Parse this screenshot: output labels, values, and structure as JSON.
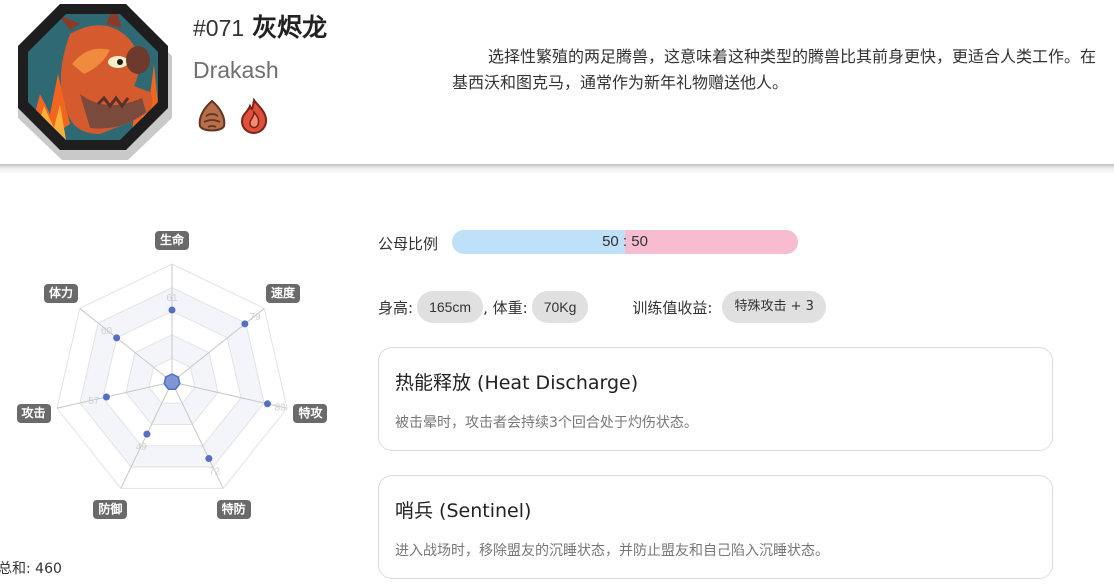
{
  "monster": {
    "number": "#071",
    "name_cn": "灰烬龙",
    "name_en": "Drakash",
    "types": [
      {
        "icon": "earth-type-icon",
        "color": "#b86e4a"
      },
      {
        "icon": "fire-type-icon",
        "color": "#e04f3a"
      }
    ],
    "description": "选择性繁殖的两足腾兽，这意味着这种类型的腾兽比其前身更快，更适合人类工作。在基西沃和图克马，通常作为新年礼物赠送他人。"
  },
  "stats": {
    "axes": [
      {
        "label": "生命",
        "value": 61
      },
      {
        "label": "速度",
        "value": 79
      },
      {
        "label": "特攻",
        "value": 83
      },
      {
        "label": "特防",
        "value": 72
      },
      {
        "label": "防御",
        "value": 49
      },
      {
        "label": "攻击",
        "value": 57
      },
      {
        "label": "体力",
        "value": 60
      }
    ],
    "max": 100,
    "total_label": "总和: 460",
    "colors": {
      "point": "#5470c6",
      "grid": "#c8c8c8",
      "band": "#f3f5fa"
    }
  },
  "gender": {
    "label": "公母比例",
    "ratio_text": "50 : 50",
    "male_fraction": 0.5,
    "male_color": "#bee0f8",
    "female_color": "#f8bcd0"
  },
  "physical": {
    "height_label": "身高:",
    "height_value": "165cm",
    "weight_label": ", 体重:",
    "weight_value": "70Kg",
    "ev_label": "训练值收益:",
    "ev_value": "特殊攻击 + 3"
  },
  "abilities": [
    {
      "title": "热能释放 (Heat Discharge)",
      "desc": "被击晕时，攻击者会持续3个回合处于灼伤状态。"
    },
    {
      "title": "哨兵 (Sentinel)",
      "desc": "进入战场时，移除盟友的沉睡状态，并防止盟友和自己陷入沉睡状态。"
    }
  ]
}
